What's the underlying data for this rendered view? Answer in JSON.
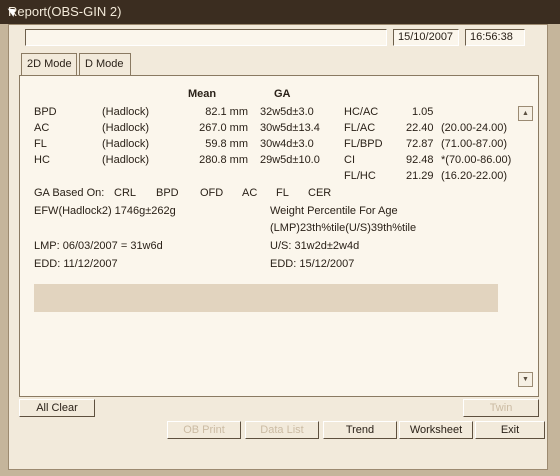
{
  "window": {
    "title": "Report(OBS-GIN 2)"
  },
  "header": {
    "patient_field": "",
    "date": "15/10/2007",
    "time": "16:56:38"
  },
  "tabs": [
    {
      "label": "2D Mode"
    },
    {
      "label": "D Mode"
    }
  ],
  "table": {
    "col_mean": "Mean",
    "col_ga": "GA",
    "rows": [
      {
        "name": "BPD",
        "method": "(Hadlock)",
        "mean": "82.1 mm",
        "ga": "32w5d±3.0"
      },
      {
        "name": "AC",
        "method": "(Hadlock)",
        "mean": "267.0 mm",
        "ga": "30w5d±13.4"
      },
      {
        "name": "FL",
        "method": "(Hadlock)",
        "mean": "59.8 mm",
        "ga": "30w4d±3.0"
      },
      {
        "name": "HC",
        "method": "(Hadlock)",
        "mean": "280.8 mm",
        "ga": "29w5d±10.0"
      }
    ]
  },
  "ratios": [
    {
      "name": "HC/AC",
      "value": "1.05",
      "range": ""
    },
    {
      "name": "FL/AC",
      "value": "22.40",
      "range": "(20.00-24.00)"
    },
    {
      "name": "FL/BPD",
      "value": "72.87",
      "range": "(71.00-87.00)"
    },
    {
      "name": "CI",
      "value": "92.48",
      "range": "*(70.00-86.00)"
    },
    {
      "name": "FL/HC",
      "value": "21.29",
      "range": "(16.20-22.00)"
    }
  ],
  "ga_based": {
    "label": "GA Based On:",
    "options": [
      "CRL",
      "BPD",
      "OFD",
      "AC",
      "FL",
      "CER"
    ]
  },
  "efw": "EFW(Hadlock2)  1746g±262g",
  "weight_percentile": {
    "title": "Weight Percentile For Age",
    "value": "(LMP)23th%tile(U/S)39th%tile"
  },
  "lmp": "LMP: 06/03/2007 =  31w6d",
  "us": "U/S: 31w2d±2w4d",
  "edd_lmp": "EDD: 11/12/2007",
  "edd_us": "EDD: 15/12/2007",
  "buttons": {
    "all_clear": "All Clear",
    "twin": "Twin",
    "ob_print": "OB Print",
    "data_list": "Data List",
    "trend": "Trend",
    "worksheet": "Worksheet",
    "exit": "Exit"
  },
  "colors": {
    "background": "#c5b59b",
    "titlebar": "#3b2d20",
    "window": "#f2eadb",
    "panel": "#fbf6ec"
  }
}
